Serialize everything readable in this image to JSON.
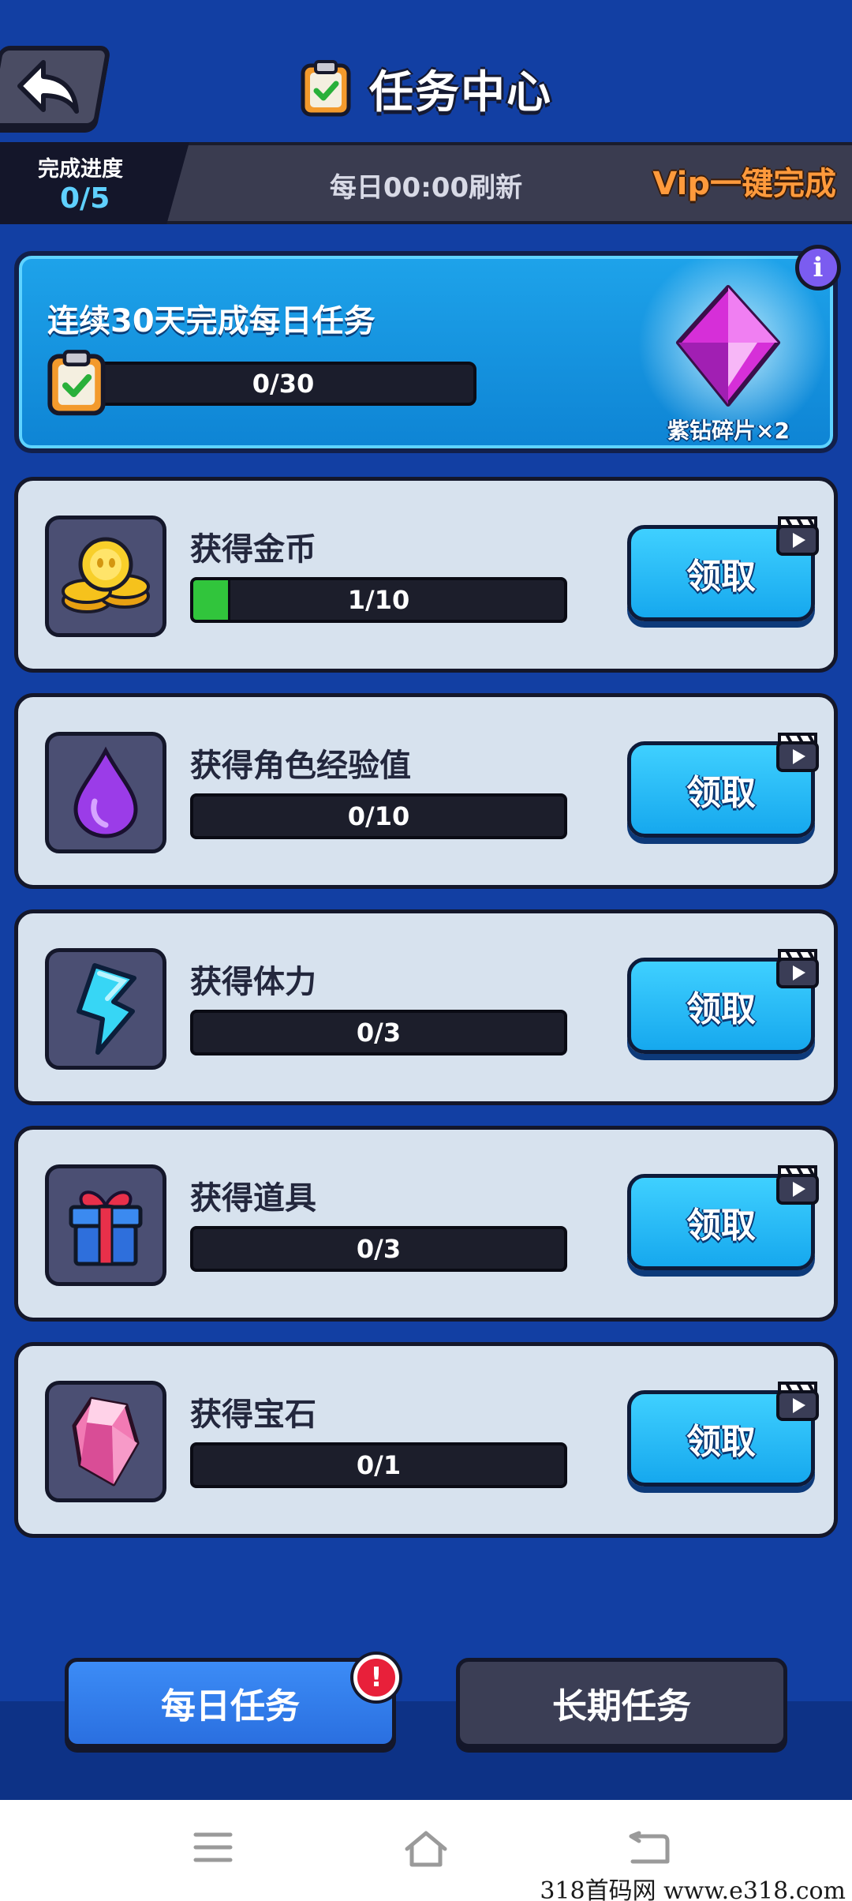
{
  "header": {
    "title": "任务中心",
    "back_icon": "back-arrow-icon",
    "title_icon": "clipboard-check-icon"
  },
  "progress": {
    "label": "完成进度",
    "value": "0/5",
    "refresh_text": "每日00:00刷新",
    "vip_label": "Vip一键完成"
  },
  "streak": {
    "title": "连续30天完成每日任务",
    "progress_text": "0/30",
    "progress_fraction": 0,
    "reward_label": "紫钻碎片×2",
    "info_label": "i"
  },
  "tasks": [
    {
      "name": "获得金币",
      "progress_text": "1/10",
      "fraction": 0.1,
      "icon": "gold-coins-icon",
      "claim_label": "领取"
    },
    {
      "name": "获得角色经验值",
      "progress_text": "0/10",
      "fraction": 0,
      "icon": "purple-exp-drop-icon",
      "claim_label": "领取"
    },
    {
      "name": "获得体力",
      "progress_text": "0/3",
      "fraction": 0,
      "icon": "lightning-energy-icon",
      "claim_label": "领取"
    },
    {
      "name": "获得道具",
      "progress_text": "0/3",
      "fraction": 0,
      "icon": "gift-box-icon",
      "claim_label": "领取"
    },
    {
      "name": "获得宝石",
      "progress_text": "0/1",
      "fraction": 0,
      "icon": "pink-gem-icon",
      "claim_label": "领取"
    }
  ],
  "tabs": {
    "daily_label": "每日任务",
    "long_label": "长期任务",
    "badge": "!"
  },
  "watermark": "318首码网 www.e318.com",
  "colors": {
    "background": "#123fa3",
    "accent_blue": "#16a8ee",
    "progress_green": "#31c53c",
    "vip_orange": "#ff9a3c"
  }
}
